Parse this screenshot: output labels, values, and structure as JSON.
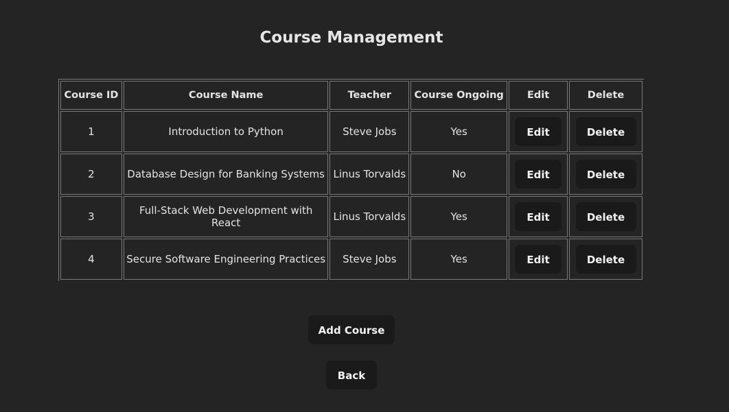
{
  "page": {
    "title": "Course Management"
  },
  "table": {
    "headers": {
      "course_id": "Course ID",
      "course_name": "Course Name",
      "teacher": "Teacher",
      "course_ongoing": "Course Ongoing",
      "edit": "Edit",
      "delete": "Delete"
    },
    "rows": [
      {
        "id": "1",
        "name": "Introduction to Python",
        "teacher": "Steve Jobs",
        "ongoing": "Yes",
        "edit_label": "Edit",
        "delete_label": "Delete"
      },
      {
        "id": "2",
        "name": "Database Design for Banking Systems",
        "teacher": "Linus Torvalds",
        "ongoing": "No",
        "edit_label": "Edit",
        "delete_label": "Delete"
      },
      {
        "id": "3",
        "name": "Full-Stack Web Development with React",
        "teacher": "Linus Torvalds",
        "ongoing": "Yes",
        "edit_label": "Edit",
        "delete_label": "Delete"
      },
      {
        "id": "4",
        "name": "Secure Software Engineering Practices",
        "teacher": "Steve Jobs",
        "ongoing": "Yes",
        "edit_label": "Edit",
        "delete_label": "Delete"
      }
    ]
  },
  "actions": {
    "add_course_label": "Add Course",
    "back_label": "Back"
  },
  "colors": {
    "background": "#242424",
    "button": "#1a1a1a",
    "border": "#7a7a7a",
    "text": "#e4e4e4"
  }
}
